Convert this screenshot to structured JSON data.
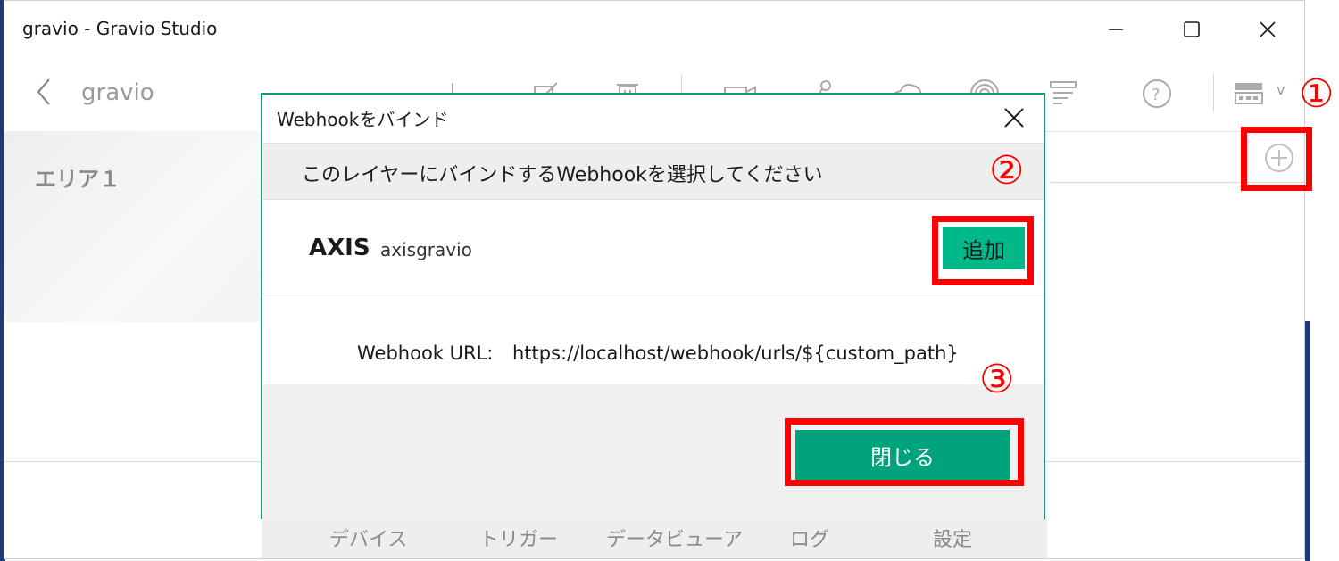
{
  "window": {
    "title": "gravio - Gravio Studio",
    "min_icon": "minimize-icon",
    "max_icon": "maximize-icon",
    "close_icon": "close-icon"
  },
  "toolbar": {
    "breadcrumb": "gravio",
    "icons": [
      "back-icon",
      "add-icon",
      "edit-icon",
      "delete-icon",
      "camera-icon",
      "robot-icon",
      "mqtt-icon",
      "fingerprint-icon",
      "list-icon",
      "help-icon",
      "layout-icon",
      "chevron-down-icon"
    ],
    "chevron": "v"
  },
  "area": {
    "label": "エリア１"
  },
  "bottom_nav": {
    "items": [
      {
        "label": "デバイス"
      },
      {
        "label": "トリガー"
      },
      {
        "label": "データビューア"
      },
      {
        "label": "ログ"
      },
      {
        "label": "設定"
      }
    ]
  },
  "dialog": {
    "title": "Webhookをバインド",
    "instruction": "このレイヤーにバインドするWebhookを選択してください",
    "webhook": {
      "name": "AXIS",
      "id": "axisgravio",
      "add_label": "追加"
    },
    "url_label": "Webhook URL:",
    "url_value": "https://localhost/webhook/urls/${custom_path}",
    "close_label": "閉じる"
  },
  "annotations": {
    "marker1": "①",
    "marker2": "②",
    "marker3": "③",
    "highlight_color": "#ff0000"
  },
  "colors": {
    "accent": "#00a37c",
    "add_button": "#00b98a",
    "dialog_border": "#0f9a7a"
  }
}
